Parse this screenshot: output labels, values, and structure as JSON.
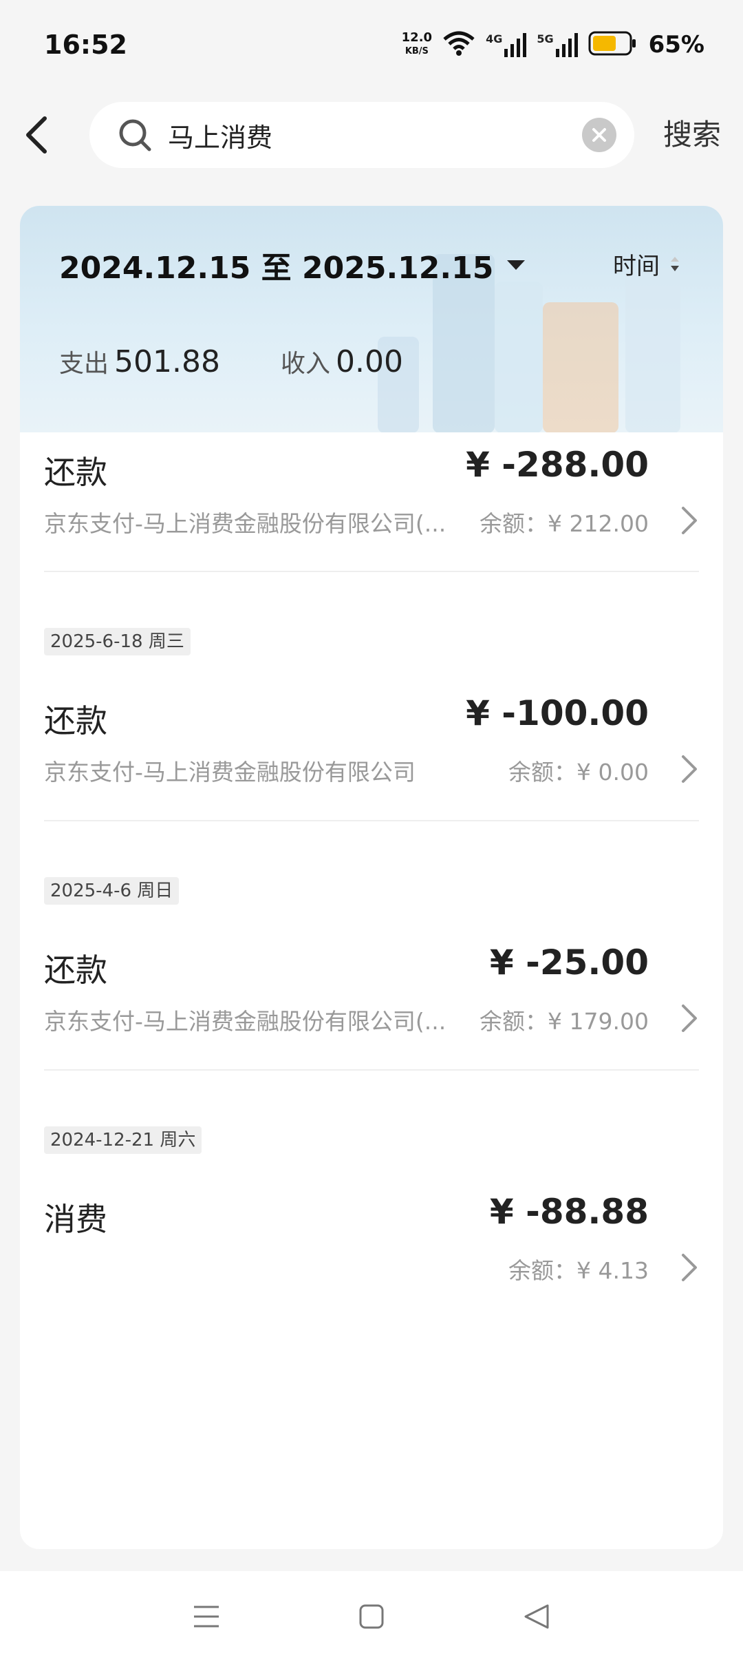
{
  "status_bar": {
    "time": "16:52",
    "net_speed": "12.0",
    "net_speed_unit": "KB/S",
    "signal_1": "4G",
    "signal_2": "5G",
    "battery": "65%",
    "battery_level": 0.65,
    "battery_color": "#f5b800"
  },
  "search": {
    "query": "马上消费",
    "action_label": "搜索"
  },
  "filter": {
    "date_range": "2024.12.15 至 2025.12.15",
    "sort_label": "时间"
  },
  "summary": {
    "expense_label": "支出",
    "expense_value": "501.88",
    "income_label": "收入",
    "income_value": "0.00"
  },
  "transactions": [
    {
      "date": "",
      "type": "还款",
      "amount": "¥ -288.00",
      "merchant": "京东支付-马上消费金融股份有限公司(...",
      "balance": "余额：¥ 212.00"
    },
    {
      "date": "2025-6-18 周三",
      "type": "还款",
      "amount": "¥ -100.00",
      "merchant": "京东支付-马上消费金融股份有限公司",
      "balance": "余额：¥ 0.00"
    },
    {
      "date": "2025-4-6 周日",
      "type": "还款",
      "amount": "¥ -25.00",
      "merchant": "京东支付-马上消费金融股份有限公司(...",
      "balance": "余额：¥ 179.00"
    },
    {
      "date": "2024-12-21 周六",
      "type": "消费",
      "amount": "¥ -88.88",
      "merchant": "",
      "balance": "余额：¥ 4.13"
    }
  ],
  "icons": {
    "back": "back-arrow-icon",
    "search": "search-icon",
    "clear": "clear-icon",
    "dropdown": "triangle-down-icon",
    "chevron": "chevron-right-icon",
    "nav_menu": "menu-icon",
    "nav_home": "square-icon",
    "nav_back": "triangle-back-icon"
  }
}
